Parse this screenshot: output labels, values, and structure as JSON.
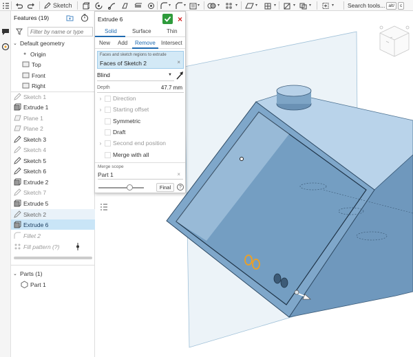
{
  "toolbar": {
    "sketch_label": "Sketch",
    "search_label": "Search tools...",
    "shortcut_alt": "alt/",
    "shortcut_c": "c"
  },
  "features": {
    "title": "Features (19)",
    "filter_placeholder": "Filter by name or type",
    "default_geometry": "Default geometry",
    "items": [
      {
        "label": "Origin"
      },
      {
        "label": "Top"
      },
      {
        "label": "Front"
      },
      {
        "label": "Right"
      },
      {
        "label": "Sketch 1"
      },
      {
        "label": "Extrude 1"
      },
      {
        "label": "Plane 1"
      },
      {
        "label": "Plane 2"
      },
      {
        "label": "Sketch 3"
      },
      {
        "label": "Sketch 4"
      },
      {
        "label": "Sketch 5"
      },
      {
        "label": "Sketch 6"
      },
      {
        "label": "Extrude 2"
      },
      {
        "label": "Sketch 7"
      },
      {
        "label": "Extrude 5"
      },
      {
        "label": "Sketch 2"
      },
      {
        "label": "Extrude 6"
      },
      {
        "label": "Fillet 2"
      },
      {
        "label": "Fill pattern (?)"
      }
    ],
    "parts_header": "Parts (1)",
    "part_item": "Part 1"
  },
  "dialog": {
    "title": "Extrude 6",
    "tabs": [
      "Solid",
      "Surface",
      "Thin"
    ],
    "ops": [
      "New",
      "Add",
      "Remove",
      "Intersect"
    ],
    "selection_label": "Faces and sketch regions to extrude",
    "selection_value": "Faces of Sketch 2",
    "end_type": "Blind",
    "depth_label": "Depth",
    "depth_value": "47.7 mm",
    "direction": "Direction",
    "starting_offset": "Starting offset",
    "symmetric": "Symmetric",
    "draft": "Draft",
    "second_end": "Second end position",
    "merge_with_all": "Merge with all",
    "merge_scope_label": "Merge scope",
    "merge_scope_value": "Part 1",
    "final_label": "Final",
    "help": "?",
    "close": "×"
  },
  "colors": {
    "accent": "#1e6ab0",
    "ok_green": "#2e9b3b",
    "cancel_red": "#d32222",
    "selection_bg": "#c9e5f7",
    "part_fill": "#7fa9cc",
    "plane_fill": "#d9e8f2",
    "highlight_orange": "#f0a020"
  }
}
